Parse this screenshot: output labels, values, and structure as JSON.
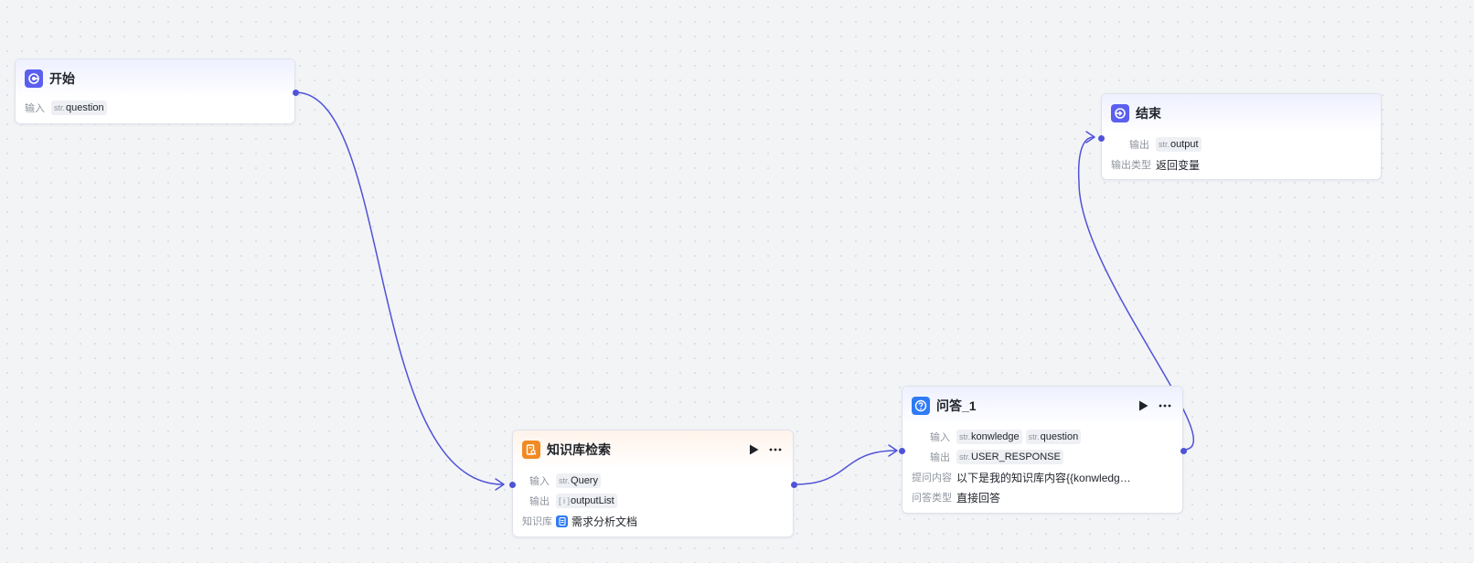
{
  "nodes": {
    "start": {
      "title": "开始",
      "input_label": "输入",
      "inputs": [
        {
          "type": "str.",
          "name": "question"
        }
      ]
    },
    "kb_search": {
      "title": "知识库检索",
      "input_label": "输入",
      "inputs": [
        {
          "type": "str.",
          "name": "Query"
        }
      ],
      "output_label": "输出",
      "outputs": [
        {
          "type": "[ i ]",
          "name": "outputList"
        }
      ],
      "kb_label": "知识库",
      "kb_value": "需求分析文档"
    },
    "qa": {
      "title": "问答_1",
      "input_label": "输入",
      "inputs": [
        {
          "type": "str.",
          "name": "konwledge"
        },
        {
          "type": "str.",
          "name": "question"
        }
      ],
      "output_label": "输出",
      "outputs": [
        {
          "type": "str.",
          "name": "USER_RESPONSE"
        }
      ],
      "prompt_label": "提问内容",
      "prompt_value": "以下是我的知识库内容{{konwledg…",
      "answer_type_label": "问答类型",
      "answer_type_value": "直接回答"
    },
    "end": {
      "title": "结束",
      "output_label": "输出",
      "outputs": [
        {
          "type": "str.",
          "name": "output"
        }
      ],
      "output_type_label": "输出类型",
      "output_type_value": "返回变量"
    }
  },
  "icons": {
    "start": "start-icon",
    "kb_search": "knowledge-search-icon",
    "qa": "question-icon",
    "end": "end-icon",
    "run": "play-icon",
    "more": "more-icon",
    "kb": "document-icon"
  },
  "colors": {
    "accent": "#5b5ff0",
    "edge": "#4f53d8",
    "kb_orange": "#f08a24",
    "qa_blue": "#2f7bf5"
  }
}
